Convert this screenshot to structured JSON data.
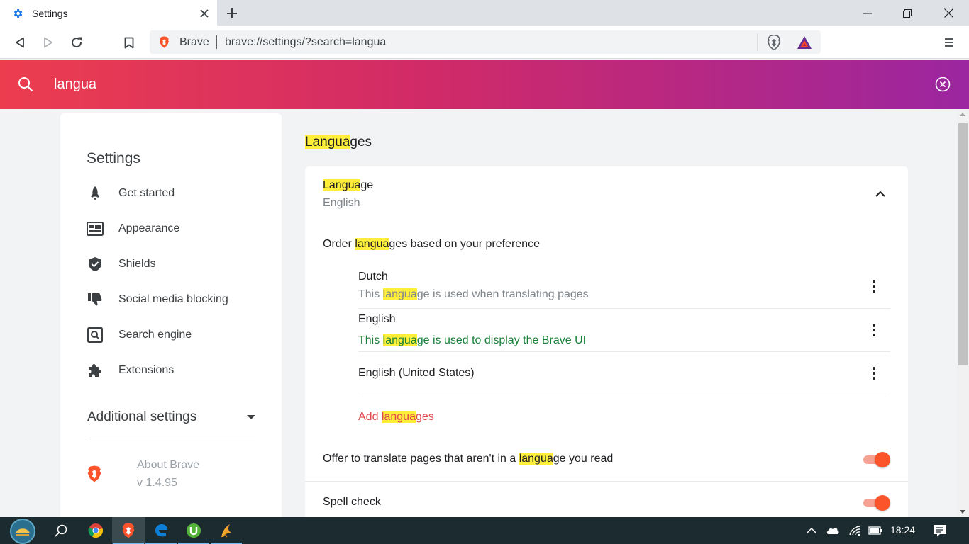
{
  "window": {
    "tab_title": "Settings"
  },
  "toolbar": {
    "scheme_label": "Brave",
    "url": "brave://settings/?search=langua"
  },
  "search": {
    "query": "langua"
  },
  "nav": {
    "title": "Settings",
    "items": [
      {
        "label": "Get started",
        "icon": "rocket-icon"
      },
      {
        "label": "Appearance",
        "icon": "appearance-icon"
      },
      {
        "label": "Shields",
        "icon": "shield-icon"
      },
      {
        "label": "Social media blocking",
        "icon": "thumbs-down-icon"
      },
      {
        "label": "Search engine",
        "icon": "search-engine-icon"
      },
      {
        "label": "Extensions",
        "icon": "puzzle-icon"
      }
    ],
    "additional_settings": "Additional settings",
    "about_name": "About Brave",
    "about_version": "v 1.4.95"
  },
  "main": {
    "section_title_hl": "Langua",
    "section_title_rest": "ges",
    "language_head_hl": "Langua",
    "language_head_rest": "ge",
    "current_language": "English",
    "order_pre": "Order ",
    "order_hl": "langua",
    "order_post": "ges based on your preference",
    "languages": [
      {
        "name": "Dutch",
        "desc_pre": "This ",
        "desc_hl": "langua",
        "desc_post": "ge is used when translating pages",
        "desc_color": "#80868b"
      },
      {
        "name": "English",
        "desc_pre": "This ",
        "desc_hl": "langua",
        "desc_post": "ge is used to display the Brave UI",
        "desc_color": "#188038"
      },
      {
        "name": "English (United States)",
        "desc_pre": "",
        "desc_hl": "",
        "desc_post": "",
        "desc_color": "#80868b"
      }
    ],
    "add_pre": "Add ",
    "add_hl": "langua",
    "add_post": "ges",
    "translate_pre": "Offer to translate pages that aren't in a ",
    "translate_hl": "langua",
    "translate_post": "ge you read",
    "translate_on": true,
    "spell_check": "Spell check",
    "spell_on": true
  },
  "taskbar": {
    "clock": "18:24"
  },
  "colors": {
    "accent": "#fb542b",
    "highlight": "#ffef3b",
    "add_link": "#e0484d",
    "success_text": "#188038"
  }
}
